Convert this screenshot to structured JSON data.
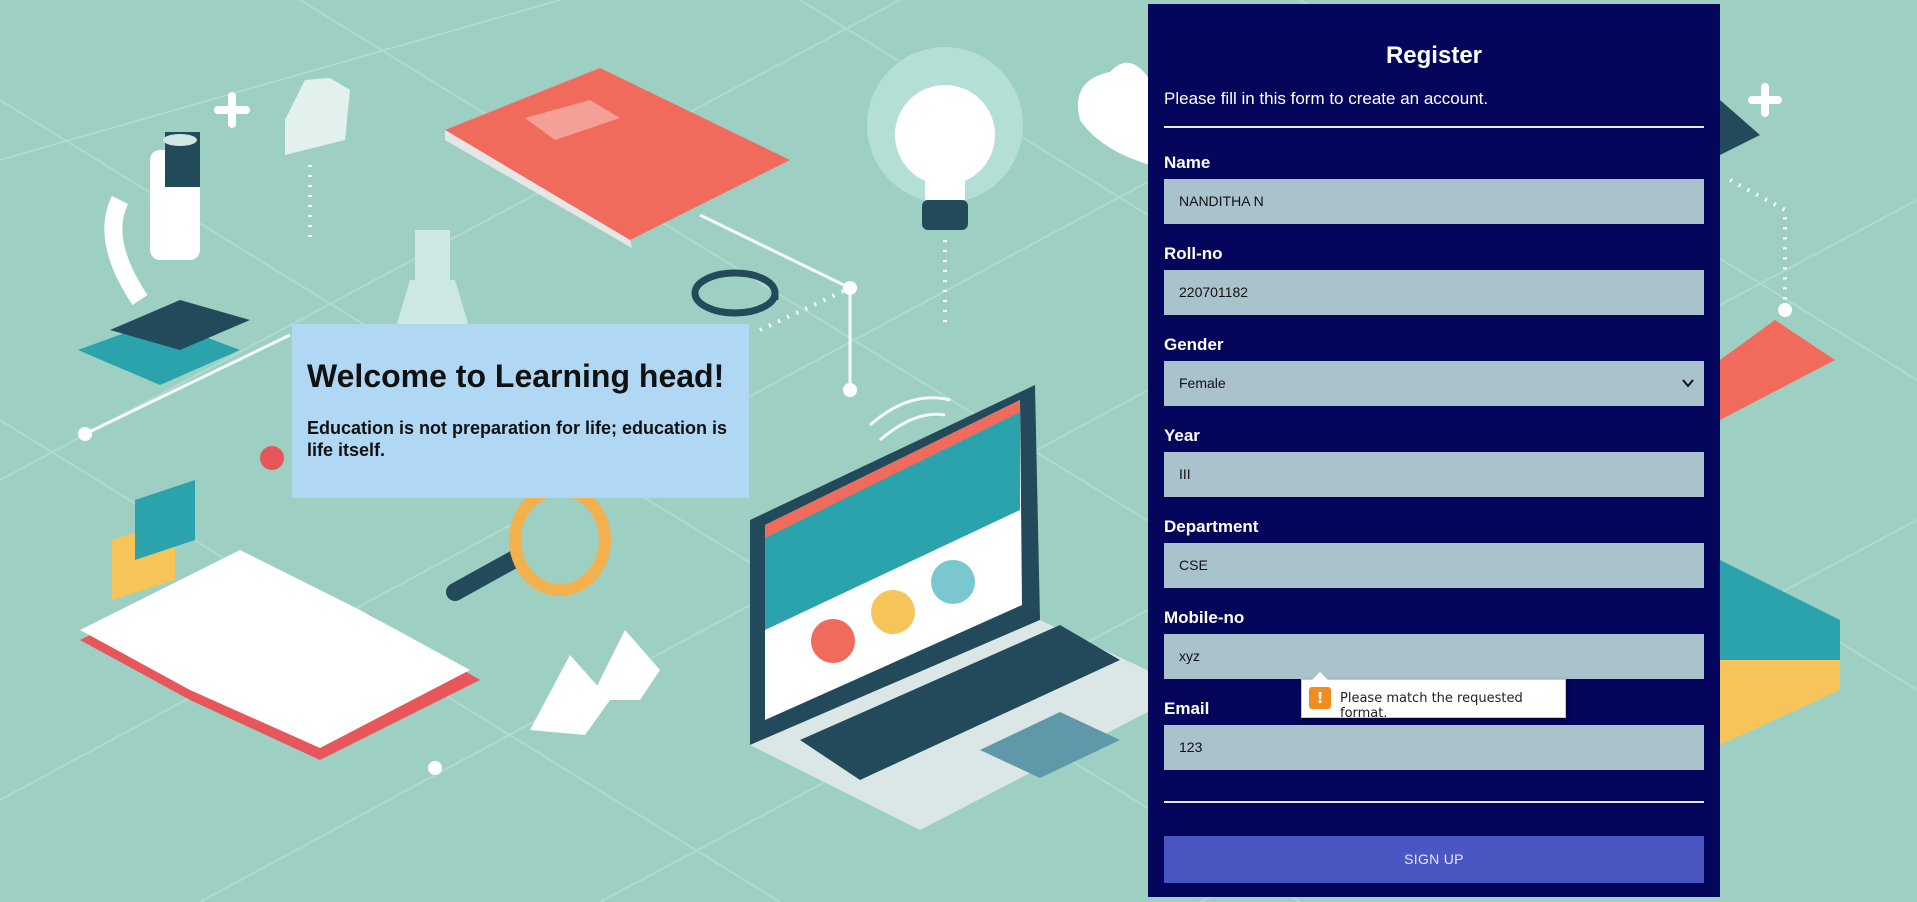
{
  "welcome": {
    "title": "Welcome to Learning head!",
    "quote": "Education is not preparation for life; education is life itself."
  },
  "form": {
    "title": "Register",
    "subtitle": "Please fill in this form to create an account.",
    "fields": [
      {
        "label": "Name",
        "value": "NANDITHA N"
      },
      {
        "label": "Roll-no",
        "value": "220701182"
      },
      {
        "label": "Gender",
        "value": "Female"
      },
      {
        "label": "Year",
        "value": "III"
      },
      {
        "label": "Department",
        "value": "CSE"
      },
      {
        "label": "Mobile-no",
        "value": "xyz"
      },
      {
        "label": "Email",
        "value": "123"
      }
    ],
    "submit_label": "SIGN UP"
  },
  "validation": {
    "message": "Please match the requested format.",
    "icon": "warning-icon"
  },
  "colors": {
    "background": "#9dd0c3",
    "panel": "#03065b",
    "input": "#a9c2cb",
    "button": "#4a57c3",
    "welcome_box": "#b0d8f4"
  }
}
